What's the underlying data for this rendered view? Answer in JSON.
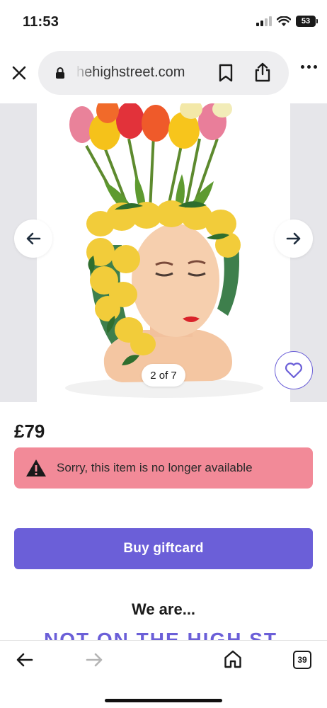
{
  "status": {
    "time": "11:53",
    "battery": "53"
  },
  "browser": {
    "url": "hehighstreet.com",
    "tab_count": "39"
  },
  "gallery": {
    "counter": "2 of 7"
  },
  "product": {
    "price": "£79",
    "alert_message": "Sorry, this item is no longer available",
    "buy_label": "Buy giftcard"
  },
  "footer": {
    "we_are": "We are...",
    "logo_text": "NOT ON THE HIGH ST"
  },
  "icons": {
    "close": "close-icon",
    "lock": "lock-icon",
    "bookmark": "bookmark-icon",
    "share": "share-icon",
    "more": "more-icon",
    "prev": "arrow-left-icon",
    "next": "arrow-right-icon",
    "favorite": "heart-icon",
    "warning": "warning-icon",
    "back": "back-icon",
    "forward": "forward-icon",
    "home": "home-icon",
    "tabs": "tabs-icon"
  },
  "colors": {
    "accent": "#6b5fd8",
    "alert_bg": "#f28a98",
    "gallery_side": "#e6e6ea"
  }
}
